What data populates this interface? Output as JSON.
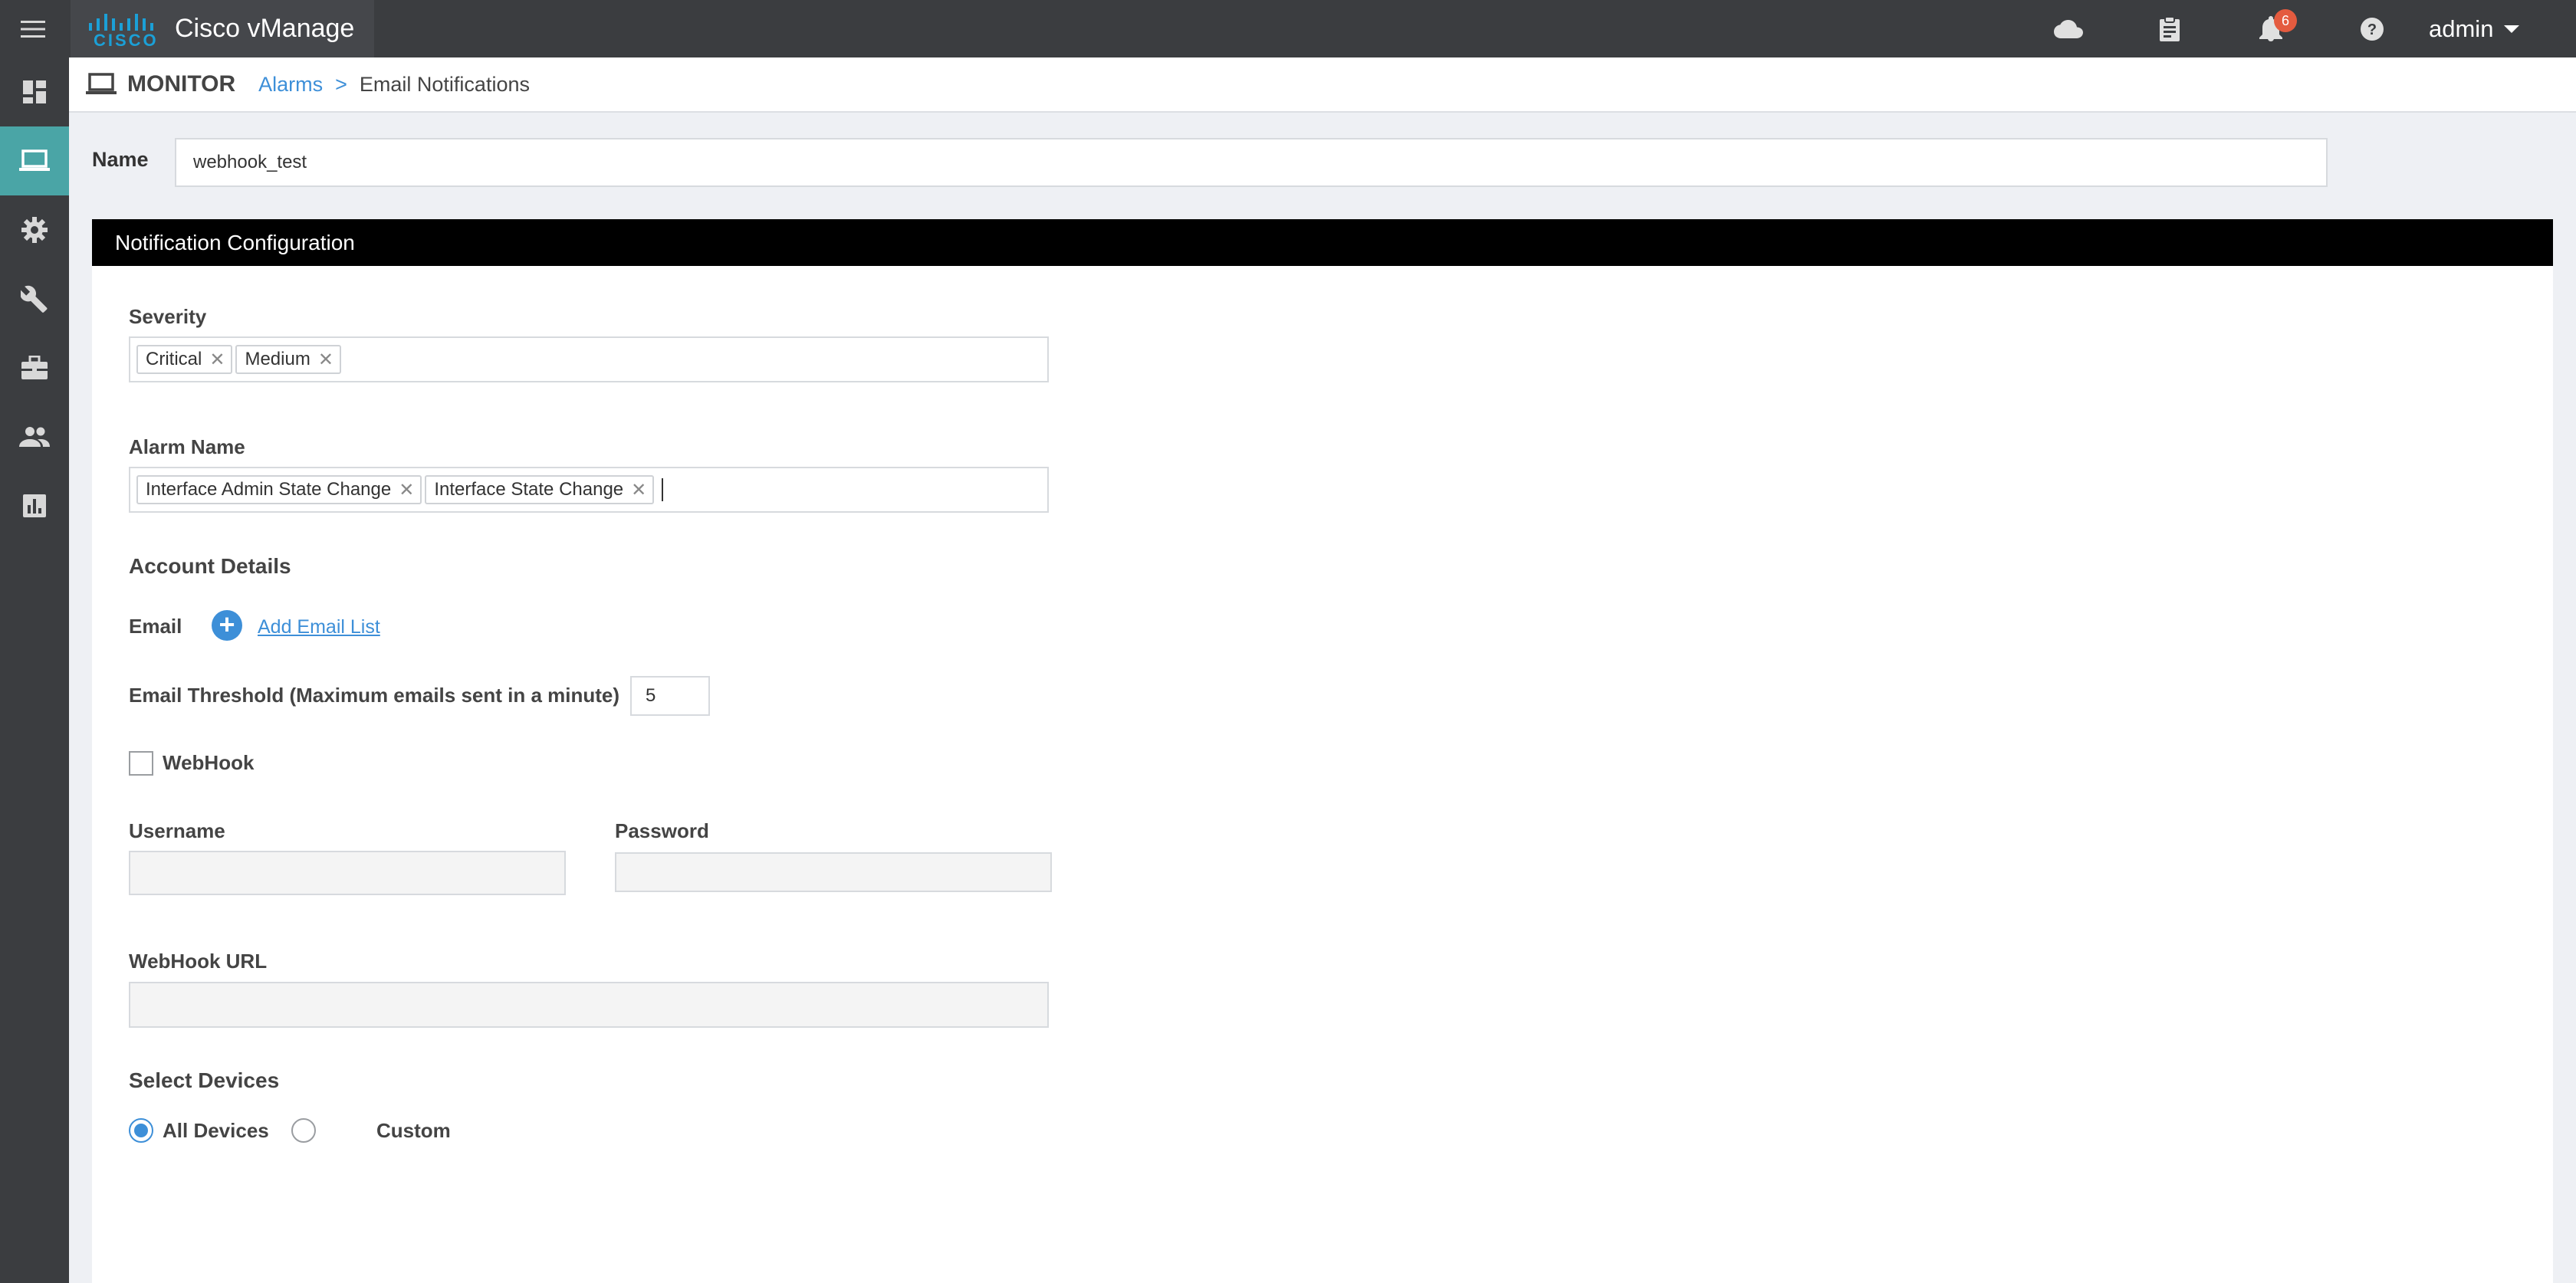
{
  "app": {
    "title": "Cisco vManage",
    "logo_text": "CISCO"
  },
  "topbar": {
    "icons": [
      "cloud-icon",
      "clipboard-icon",
      "bell-icon",
      "help-icon"
    ],
    "notification_count": "6",
    "user": "admin"
  },
  "sidebar": {
    "items": [
      {
        "icon": "dashboard-icon",
        "active": false
      },
      {
        "icon": "monitor-icon",
        "active": true
      },
      {
        "icon": "gear-icon",
        "active": false
      },
      {
        "icon": "wrench-icon",
        "active": false
      },
      {
        "icon": "briefcase-icon",
        "active": false
      },
      {
        "icon": "users-icon",
        "active": false
      },
      {
        "icon": "analytics-icon",
        "active": false
      }
    ]
  },
  "header": {
    "section": "MONITOR",
    "breadcrumb_link": "Alarms",
    "breadcrumb_sep": ">",
    "breadcrumb_current": "Email Notifications"
  },
  "form": {
    "name_label": "Name",
    "name_value": "webhook_test",
    "panel_title": "Notification Configuration",
    "severity_label": "Severity",
    "severity_tags": [
      "Critical",
      "Medium"
    ],
    "alarm_name_label": "Alarm Name",
    "alarm_name_tags": [
      "Interface Admin State Change",
      "Interface State Change"
    ],
    "account_details_label": "Account Details",
    "email_label": "Email",
    "add_email_list": "Add Email List",
    "email_threshold_label": "Email Threshold (Maximum emails sent in a minute)",
    "email_threshold_value": "5",
    "webhook_label": "WebHook",
    "webhook_checked": false,
    "username_label": "Username",
    "password_label": "Password",
    "webhook_url_label": "WebHook URL",
    "select_devices_label": "Select Devices",
    "device_options": [
      {
        "label": "All Devices",
        "checked": true
      },
      {
        "label": "Custom",
        "checked": false
      }
    ]
  },
  "colors": {
    "topbar": "#3b3d40",
    "active_nav": "#4aa5a6",
    "link": "#3d8fd8",
    "badge": "#e45b3f"
  }
}
